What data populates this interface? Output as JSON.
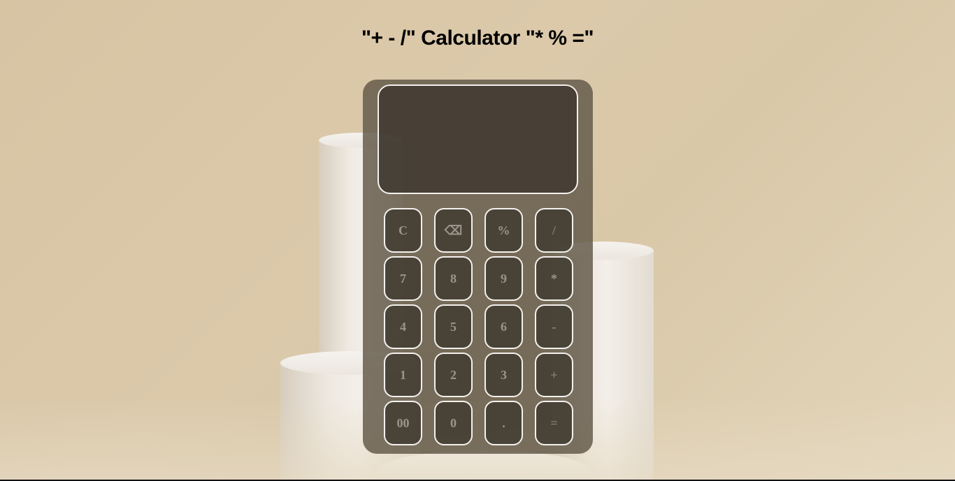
{
  "page": {
    "title": "\"+ - /\" Calculator \"* % =\""
  },
  "calculator": {
    "display_value": "",
    "keys": [
      {
        "label": "C",
        "name": "clear-button"
      },
      {
        "label": "⌫",
        "name": "backspace-button"
      },
      {
        "label": "%",
        "name": "percent-button"
      },
      {
        "label": "/",
        "name": "divide-button"
      },
      {
        "label": "7",
        "name": "digit-7-button"
      },
      {
        "label": "8",
        "name": "digit-8-button"
      },
      {
        "label": "9",
        "name": "digit-9-button"
      },
      {
        "label": "*",
        "name": "multiply-button"
      },
      {
        "label": "4",
        "name": "digit-4-button"
      },
      {
        "label": "5",
        "name": "digit-5-button"
      },
      {
        "label": "6",
        "name": "digit-6-button"
      },
      {
        "label": "-",
        "name": "subtract-button"
      },
      {
        "label": "1",
        "name": "digit-1-button"
      },
      {
        "label": "2",
        "name": "digit-2-button"
      },
      {
        "label": "3",
        "name": "digit-3-button"
      },
      {
        "label": "+",
        "name": "add-button"
      },
      {
        "label": "00",
        "name": "double-zero-button"
      },
      {
        "label": "0",
        "name": "digit-0-button"
      },
      {
        "label": ".",
        "name": "decimal-point-button"
      },
      {
        "label": "=",
        "name": "equals-button"
      }
    ]
  },
  "colors": {
    "background": "#d6c4a3",
    "calculator_body": "#605747",
    "key_border": "#f3f1ed",
    "key_text": "#9a958c"
  }
}
